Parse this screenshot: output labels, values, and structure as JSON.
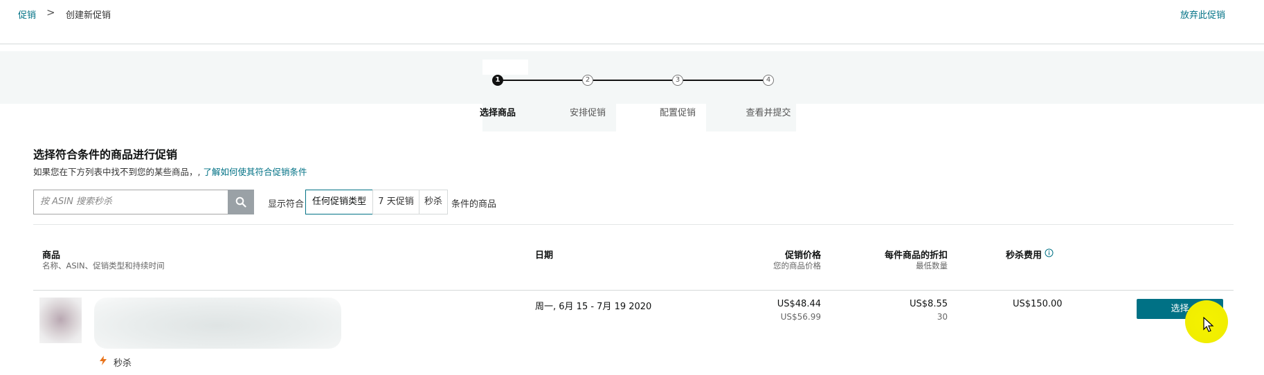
{
  "breadcrumb": {
    "parent": "促销",
    "separator": ">",
    "current": "创建新促销"
  },
  "header": {
    "abandon_label": "放弃此促销"
  },
  "stepper": {
    "steps": [
      {
        "number": "1",
        "label": "选择商品",
        "state": "active"
      },
      {
        "number": "2",
        "label": "安排促销",
        "state": "todo"
      },
      {
        "number": "3",
        "label": "配置促销",
        "state": "todo"
      },
      {
        "number": "4",
        "label": "查看并提交",
        "state": "todo"
      }
    ]
  },
  "section": {
    "title": "选择符合条件的商品进行促销",
    "subtitle_prefix": "如果您在下方列表中找不到您的某些商品，, ",
    "subtitle_link": "了解如何使其符合促销条件"
  },
  "search": {
    "placeholder": "按 ASIN 搜索秒杀",
    "icon": "search-icon"
  },
  "filter": {
    "prefix": "显示符合",
    "options": [
      "任何促销类型",
      "7 天促销",
      "秒杀"
    ],
    "selected": "任何促销类型",
    "suffix": "条件的商品"
  },
  "table": {
    "columns": {
      "product": {
        "title": "商品",
        "subtitle": "名称、ASIN、促销类型和持续时间"
      },
      "date": {
        "title": "日期"
      },
      "price": {
        "title": "促销价格",
        "subtitle": "您的商品价格"
      },
      "discount": {
        "title": "每件商品的折扣",
        "subtitle": "最低数量"
      },
      "fee": {
        "title": "秒杀费用",
        "icon": "info-icon"
      }
    },
    "rows": [
      {
        "deal_type": "秒杀",
        "date": "周一, 6月 15 - 7月 19 2020",
        "deal_price": "US$48.44",
        "your_price": "US$56.99",
        "discount": "US$8.55",
        "min_qty": "30",
        "fee": "US$150.00",
        "action_label": "选择"
      }
    ]
  },
  "colors": {
    "accent": "#007185",
    "highlight": "#f1ee00",
    "search_button": "#9aa1a6"
  }
}
